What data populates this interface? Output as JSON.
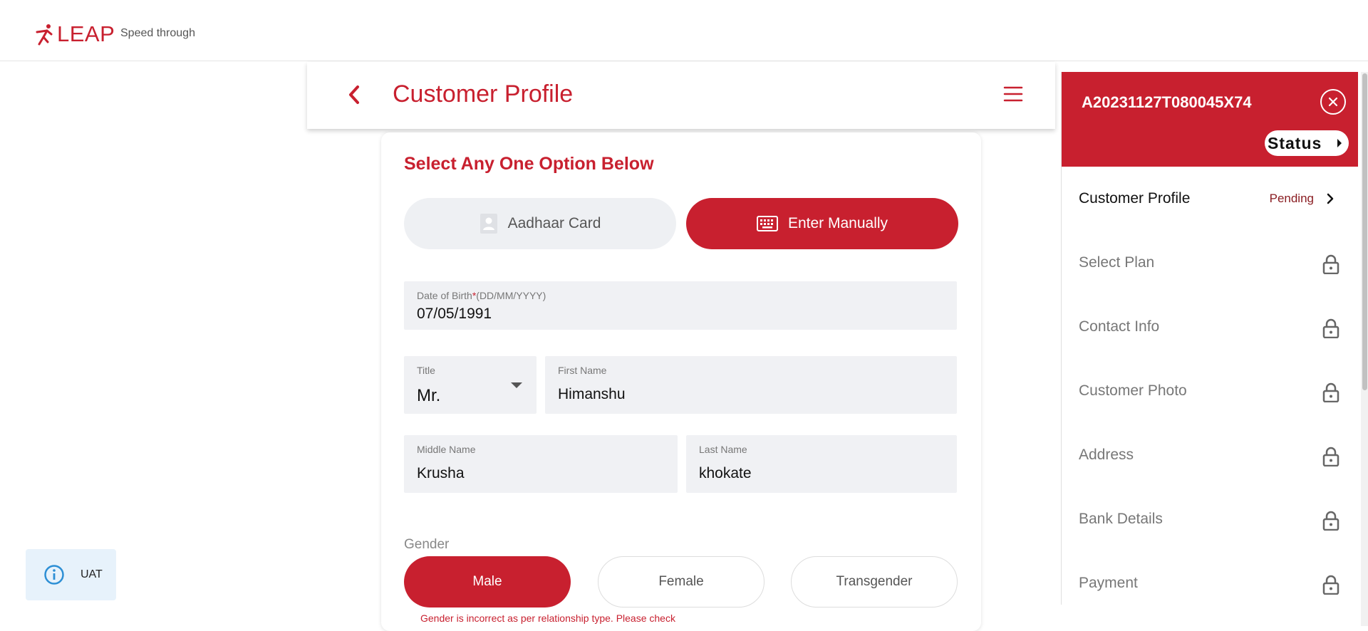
{
  "header": {
    "logo_text": "LEAP",
    "tagline": "Speed through"
  },
  "page": {
    "title": "Customer Profile",
    "back_icon": "chevron-left-icon",
    "menu_icon": "hamburger-menu-icon"
  },
  "form": {
    "section_title": "Select Any One Option Below",
    "options": {
      "aadhaar_label": "Aadhaar Card",
      "manual_label": "Enter Manually",
      "selected": "Enter Manually"
    },
    "dob": {
      "label": "Date of Birth",
      "required_mark": "*",
      "format_hint": "(DD/MM/YYYY)",
      "value": "07/05/1991"
    },
    "title": {
      "label": "Title",
      "value": "Mr."
    },
    "first_name": {
      "label": "First Name",
      "value": "Himanshu"
    },
    "middle_name": {
      "label": "Middle Name",
      "value": "Krusha"
    },
    "last_name": {
      "label": "Last Name",
      "value": "khokate"
    },
    "gender": {
      "label": "Gender",
      "options": [
        "Male",
        "Female",
        "Transgender"
      ],
      "selected": "Male",
      "error": "Gender is incorrect as per relationship type. Please check"
    }
  },
  "side_panel": {
    "application_id": "A20231127T080045X74",
    "status_label": "Status",
    "items": [
      {
        "label": "Customer Profile",
        "state": "Pending",
        "active": true
      },
      {
        "label": "Select Plan",
        "locked": true
      },
      {
        "label": "Contact Info",
        "locked": true
      },
      {
        "label": "Customer Photo",
        "locked": true
      },
      {
        "label": "Address",
        "locked": true
      },
      {
        "label": "Bank Details",
        "locked": true
      },
      {
        "label": "Payment",
        "locked": true
      }
    ]
  },
  "env_badge": {
    "label": "UAT",
    "icon": "info-icon"
  },
  "colors": {
    "brand_red": "#c8202f",
    "field_bg": "#f0f1f4",
    "badge_bg": "#e7f2fb"
  }
}
